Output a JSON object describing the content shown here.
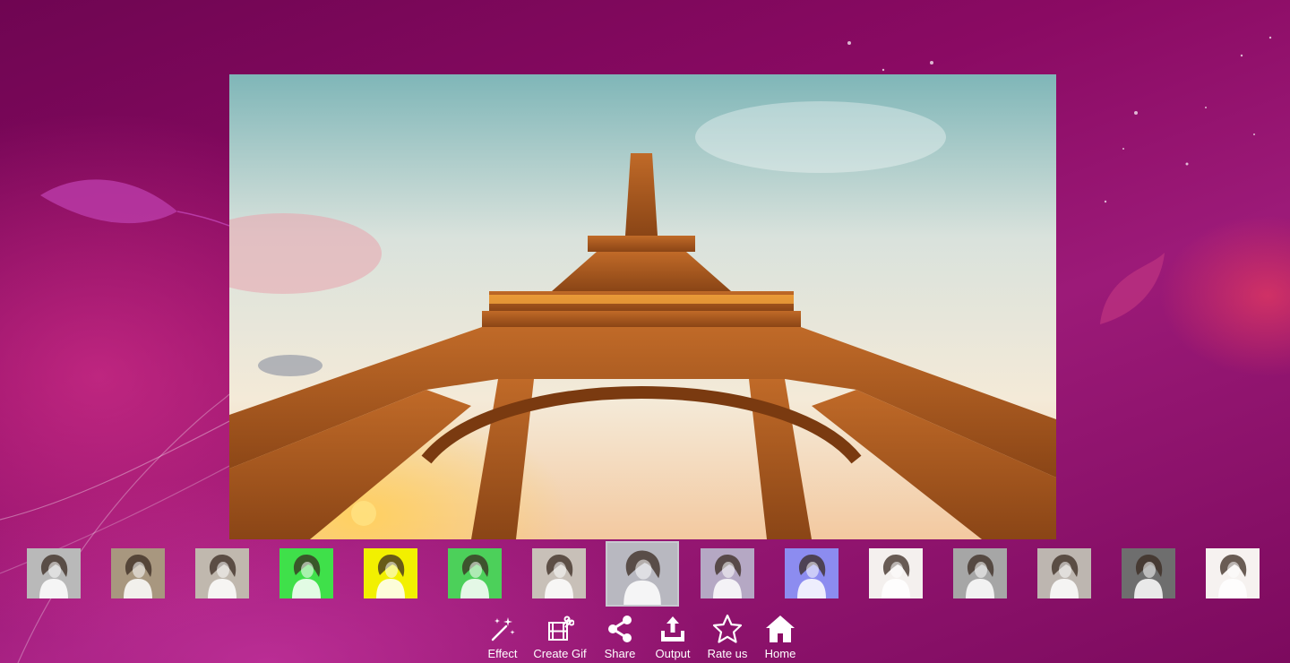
{
  "background": {
    "color": "#8a0a63"
  },
  "preview": {
    "description_icon": "eiffel-tower-photo"
  },
  "thumbnails": [
    {
      "filter": "original",
      "tint": "#b9b9b9"
    },
    {
      "filter": "sepia",
      "tint": "#a8977f"
    },
    {
      "filter": "warm-gray",
      "tint": "#c0b8ae"
    },
    {
      "filter": "green",
      "tint": "#3fe04a"
    },
    {
      "filter": "yellow",
      "tint": "#f2f000"
    },
    {
      "filter": "green-light",
      "tint": "#4cd05a"
    },
    {
      "filter": "soft",
      "tint": "#c8c0b8"
    },
    {
      "filter": "mono",
      "tint": "#b8b8c0",
      "selected": true
    },
    {
      "filter": "lilac",
      "tint": "#b5a8c4"
    },
    {
      "filter": "blue",
      "tint": "#8c8cf0"
    },
    {
      "filter": "bright",
      "tint": "#f4f0ee"
    },
    {
      "filter": "cool-gray",
      "tint": "#a6a6a6"
    },
    {
      "filter": "light-gray",
      "tint": "#bdb6b0"
    },
    {
      "filter": "dark",
      "tint": "#6e6e6e"
    },
    {
      "filter": "high-key",
      "tint": "#f6f2f0"
    }
  ],
  "toolbar": {
    "effect": {
      "label": "Effect",
      "icon": "magic-wand-icon"
    },
    "create_gif": {
      "label": "Create Gif",
      "icon": "film-scissors-icon"
    },
    "share": {
      "label": "Share",
      "icon": "share-icon"
    },
    "output": {
      "label": "Output",
      "icon": "upload-icon"
    },
    "rate_us": {
      "label": "Rate us",
      "icon": "star-icon"
    },
    "home": {
      "label": "Home",
      "icon": "home-icon"
    }
  }
}
